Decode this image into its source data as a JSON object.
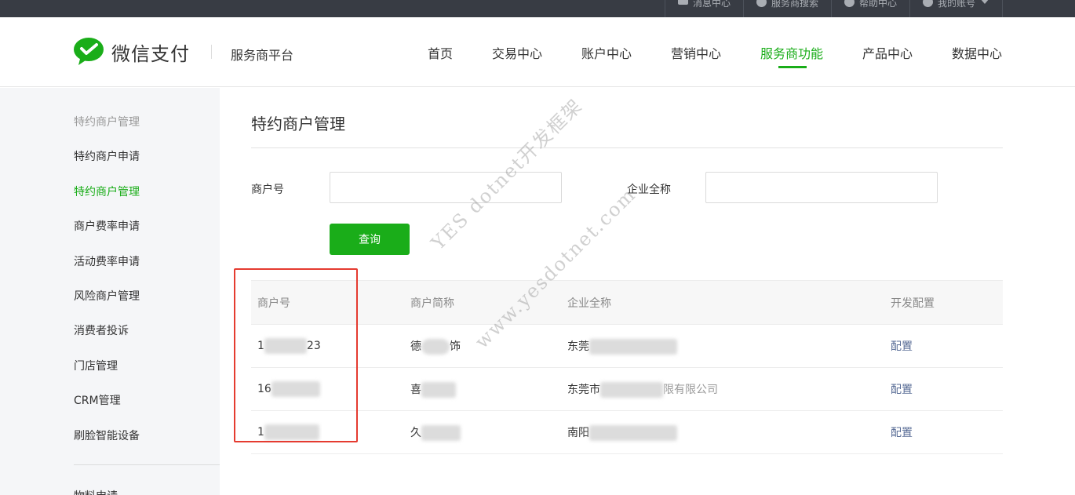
{
  "topbar": {
    "items": [
      {
        "label": "消息中心",
        "icon": "mail-icon"
      },
      {
        "label": "服务商搜索",
        "icon": "search-icon"
      },
      {
        "label": "帮助中心",
        "icon": "help-icon"
      },
      {
        "label": "我的账号",
        "icon": "user-icon"
      }
    ]
  },
  "header": {
    "logo_text": "微信支付",
    "platform": "服务商平台",
    "nav": [
      {
        "label": "首页"
      },
      {
        "label": "交易中心"
      },
      {
        "label": "账户中心"
      },
      {
        "label": "营销中心"
      },
      {
        "label": "服务商功能",
        "active": true
      },
      {
        "label": "产品中心"
      },
      {
        "label": "数据中心"
      }
    ]
  },
  "sidebar": {
    "items": [
      {
        "label": "特约商户管理",
        "type": "head"
      },
      {
        "label": "特约商户申请"
      },
      {
        "label": "特约商户管理",
        "active": true
      },
      {
        "label": "商户费率申请"
      },
      {
        "label": "活动费率申请"
      },
      {
        "label": "风险商户管理"
      },
      {
        "label": "消费者投诉"
      },
      {
        "label": "门店管理"
      },
      {
        "label": "CRM管理"
      },
      {
        "label": "刷脸智能设备"
      },
      {
        "label": "物料申请"
      }
    ]
  },
  "main": {
    "title": "特约商户管理",
    "form": {
      "merchant_no_label": "商户号",
      "merchant_no_value": "",
      "company_label": "企业全称",
      "company_value": "",
      "query_button": "查询"
    },
    "table": {
      "headers": [
        "商户号",
        "商户简称",
        "企业全称",
        "开发配置"
      ],
      "rows": [
        {
          "merchant_no_prefix": "1",
          "merchant_no_suffix": "23",
          "short_name_prefix": "德",
          "short_name_suffix": "饰",
          "company_prefix": "东莞",
          "action": "配置"
        },
        {
          "merchant_no_prefix": "16",
          "merchant_no_suffix": "",
          "short_name_prefix": "喜",
          "short_name_suffix": "",
          "company_prefix": "东莞市",
          "company_suffix": "限有限公司",
          "action": "配置"
        },
        {
          "merchant_no_prefix": "1",
          "merchant_no_suffix": "",
          "short_name_prefix": "久",
          "short_name_suffix": "",
          "company_prefix": "南阳",
          "action": "配置"
        }
      ]
    }
  },
  "watermark": {
    "line1": "YES dotnet开发框架",
    "line2": "www.yesdotnet.com"
  },
  "colors": {
    "brand_green": "#1aad19",
    "link_blue": "#576b95",
    "highlight_red": "#e53b30",
    "topbar_bg": "#383c44"
  }
}
